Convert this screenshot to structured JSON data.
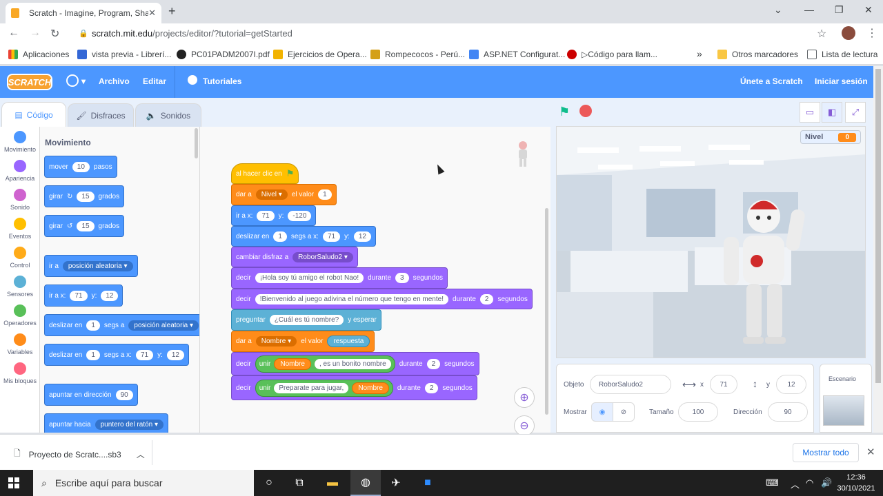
{
  "browser": {
    "tab_title": "Scratch - Imagine, Program, Shar",
    "url_host": "scratch.mit.edu",
    "url_path": "/projects/editor/?tutorial=getStarted",
    "bookmarks": [
      "Aplicaciones",
      "vista previa - Librerí...",
      "PC01PADM2007I.pdf",
      "Ejercicios de Opera...",
      "Rompecocos - Perú...",
      "ASP.NET Configurat...",
      "▷Código para llam..."
    ],
    "bookmarks_more": "»",
    "other_bookmarks": "Otros marcadores",
    "reading_list": "Lista de lectura"
  },
  "header": {
    "logo": "SCRATCH",
    "archivo": "Archivo",
    "editar": "Editar",
    "tutoriales": "Tutoriales",
    "join": "Únete a Scratch",
    "signin": "Iniciar sesión"
  },
  "tabs": {
    "code": "Código",
    "costumes": "Disfraces",
    "sounds": "Sonidos"
  },
  "categories": [
    {
      "label": "Movimiento",
      "color": "#4c97ff"
    },
    {
      "label": "Apariencia",
      "color": "#9966ff"
    },
    {
      "label": "Sonido",
      "color": "#cf63cf"
    },
    {
      "label": "Eventos",
      "color": "#ffbf00"
    },
    {
      "label": "Control",
      "color": "#ffab19"
    },
    {
      "label": "Sensores",
      "color": "#5cb1d6"
    },
    {
      "label": "Operadores",
      "color": "#59c059"
    },
    {
      "label": "Variables",
      "color": "#ff8c1a"
    },
    {
      "label": "Mis bloques",
      "color": "#ff6680"
    }
  ],
  "palette": {
    "title": "Movimiento",
    "mover": "mover",
    "mover_n": "10",
    "pasos": "pasos",
    "girar": "girar",
    "girar_n": "15",
    "grados": "grados",
    "ir_a": "ir a",
    "posicion_aleatoria": "posición aleatoria",
    "ir_a_x": "ir a x:",
    "x": "71",
    "y_lbl": "y:",
    "y": "12",
    "deslizar_en": "deslizar en",
    "uno": "1",
    "segs_a": "segs a",
    "segs_a_x": "segs a x:",
    "apuntar_dir": "apuntar en dirección",
    "dir_n": "90",
    "apuntar_hacia": "apuntar hacia",
    "puntero": "puntero del ratón"
  },
  "script": {
    "hat": "al hacer clic en",
    "dar_a": "dar a",
    "nivel": "Nivel",
    "el_valor": "el valor",
    "nivel_val": "1",
    "ir_a_x": "ir a x:",
    "x1": "71",
    "y_lbl": "y:",
    "y1": "-120",
    "deslizar_en": "deslizar en",
    "s1": "1",
    "segs_a_x": "segs a x:",
    "x2": "71",
    "y2": "12",
    "cambiar": "cambiar disfraz a",
    "disfraz": "RoborSaludo2",
    "decir": "decir",
    "msg1": "¡Hola soy tú amigo el robot Nao!",
    "durante": "durante",
    "d1": "3",
    "segundos": "segundos",
    "msg2": "!Bienvenido al juego adivina el número que tengo en mente!",
    "d2": "2",
    "preguntar": "preguntar",
    "pregunta": "¿Cuál es tú nombre?",
    "y_esperar": "y esperar",
    "nombre": "Nombre",
    "respuesta": "respuesta",
    "unir": "unir",
    "bonito": ", es un bonito nombre",
    "d3": "2",
    "preparate": "Preparate para jugar,",
    "d4": "2"
  },
  "stage": {
    "monitor_label": "Nivel",
    "monitor_value": "0"
  },
  "sprite": {
    "objeto": "Objeto",
    "name": "RoborSaludo2",
    "x_lbl": "x",
    "x": "71",
    "y_lbl": "y",
    "y": "12",
    "mostrar": "Mostrar",
    "tamano": "Tamaño",
    "size": "100",
    "direccion": "Dirección",
    "dir": "90",
    "escenario": "Escenario"
  },
  "download": {
    "file": "Proyecto de Scratc....sb3",
    "show_all": "Mostrar todo"
  },
  "taskbar": {
    "search": "Escribe aquí para buscar",
    "time": "12:36",
    "date": "30/10/2021"
  }
}
